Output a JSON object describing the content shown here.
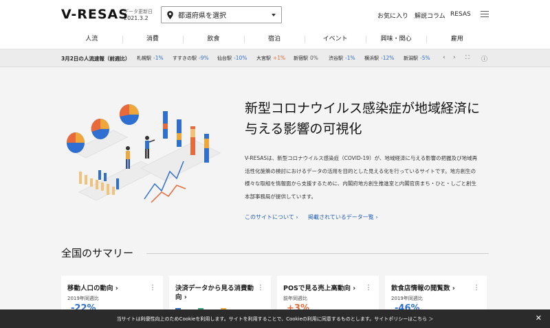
{
  "header": {
    "logo": "V-RESAS",
    "update_label": "データ更新日",
    "update_date": "2021.3.2",
    "pref_select_value": "都道府県を選択",
    "links": [
      "お気に入り",
      "解説コラム",
      "RESAS"
    ]
  },
  "nav": [
    "人流",
    "消費",
    "飲食",
    "宿泊",
    "イベント",
    "興味・関心",
    "雇用"
  ],
  "ticker": {
    "title": "3月2日の人流速報（前週比）",
    "stations": [
      {
        "name": "札幌駅",
        "value": "-1%",
        "trend": "neg"
      },
      {
        "name": "すすきの駅",
        "value": "-9%",
        "trend": "neg"
      },
      {
        "name": "仙台駅",
        "value": "-10%",
        "trend": "neg"
      },
      {
        "name": "大宮駅",
        "value": "+1%",
        "trend": "pos"
      },
      {
        "name": "新宿駅",
        "value": "0%",
        "trend": "zero"
      },
      {
        "name": "渋谷駅",
        "value": "-1%",
        "trend": "neg"
      },
      {
        "name": "横浜駅",
        "value": "-12%",
        "trend": "neg"
      },
      {
        "name": "新潟駅",
        "value": "-5%",
        "trend": "neg"
      }
    ]
  },
  "hero": {
    "title_line1": "新型コロナウイルス感染症が地域経済に",
    "title_line2": "与える影響の可視化",
    "desc": [
      "V-RESASは、新型コロナウイルス感染症（COVID-19）が、地域経済に与える影響の把握及び地域再",
      "活性化施策の検討におけるデータの活用を目的とした見える化を行っているサイトです。地方創生の",
      "様々な取組を情報面から支援するために、内閣府地方創生推進室と内閣官房まち・ひと・しごと創生",
      "本部事務局が提供しています。"
    ],
    "link_about": "このサイトについて",
    "link_data": "掲載されているデータ一覧"
  },
  "summary": {
    "title": "全国のサマリー",
    "cards": [
      {
        "title": "移動人口の動向",
        "sub": "2019年同週比",
        "value": "-22%",
        "color": "#2f6fd1"
      },
      {
        "title": "決済データから見る消費動向",
        "sub": "",
        "value": "",
        "color": "#2f6fd1"
      },
      {
        "title": "POSで見る売上高動向",
        "sub": "前年同週比",
        "value": "+3%",
        "color": "#e86a3a"
      },
      {
        "title": "飲食店情報の閲覧数",
        "sub": "2019年同週比",
        "value": "-46%",
        "color": "#2f6fd1"
      }
    ]
  },
  "cookie": {
    "text": "当サイトは利便性向上のためCookieを利用します。サイトを利用することで、Cookieの利用に同意するものとします。サイトポリシーはこちら ＞"
  },
  "colors": {
    "negative": "#2f6fd1",
    "positive": "#e86a3a"
  }
}
